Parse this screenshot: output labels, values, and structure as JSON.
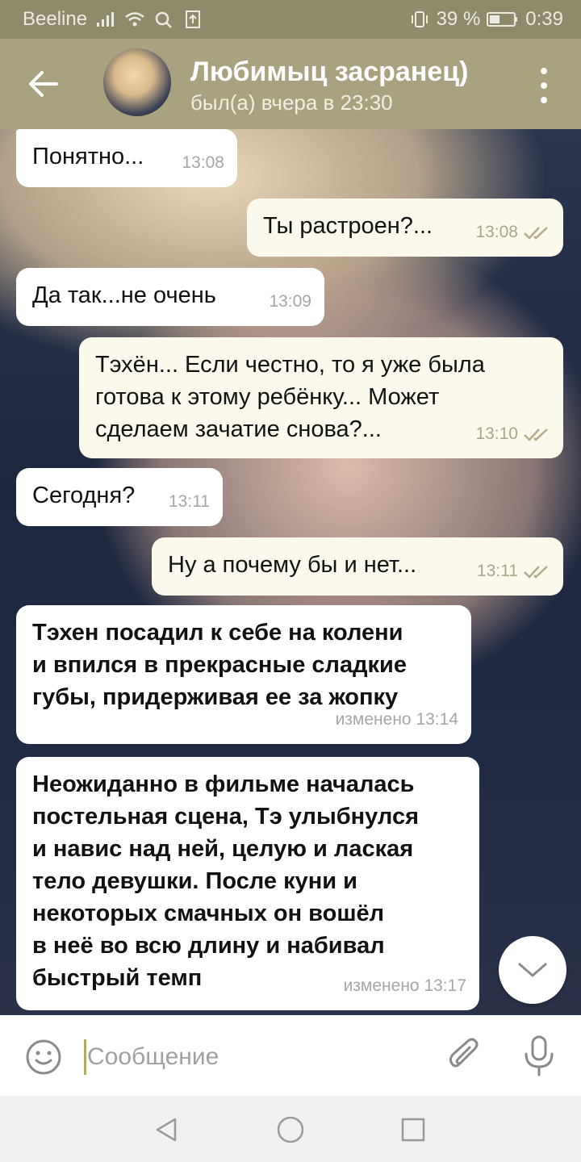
{
  "status_bar": {
    "carrier": "Beeline",
    "battery_percent": "39 %",
    "time": "0:39"
  },
  "header": {
    "back_icon": "arrow-left-icon",
    "contact_name": "Любимыц засранец)",
    "last_seen": "был(а) вчера в 23:30",
    "menu_icon": "more-vertical-icon"
  },
  "messages": [
    {
      "direction": "in",
      "text": "Понятно...",
      "time": "13:08",
      "bold": false
    },
    {
      "direction": "out",
      "text": "Ты растроен?...",
      "time": "13:08",
      "read": true,
      "bold": false
    },
    {
      "direction": "in",
      "text": "Да так...не очень",
      "time": "13:09",
      "bold": false
    },
    {
      "direction": "out",
      "text": "Тэхён... Если честно, то я уже была\nготова к этому ребёнку... Может\nсделаем зачатие снова?...",
      "time": "13:10",
      "read": true,
      "bold": false
    },
    {
      "direction": "in",
      "text": "Сегодня?",
      "time": "13:11",
      "bold": false
    },
    {
      "direction": "out",
      "text": "Ну а почему бы и нет...",
      "time": "13:11",
      "read": true,
      "bold": false
    },
    {
      "direction": "in",
      "text": "Тэхен посадил к себе на колени\nи впился в прекрасные сладкие\nгубы, придерживая ее за жопку",
      "time": "изменено 13:14",
      "bold": true
    },
    {
      "direction": "in",
      "text": "Неожиданно в фильме началась\nпостельная сцена, Тэ улыбнулся\nи навис над ней, целую и лаская\nтело девушки. После куни и\nнекоторых смачных он вошёл\nв неё во всю длину и набивал\nбыстрый темп",
      "time": "изменено 13:17",
      "bold": true
    }
  ],
  "input": {
    "placeholder": "Сообщение",
    "value": ""
  },
  "icons": {
    "emoji": "emoji-icon",
    "attach": "paperclip-icon",
    "mic": "microphone-icon",
    "scroll_down": "chevron-down-icon"
  },
  "colors": {
    "header_bg": "#a8a27e",
    "status_bg": "#8f8a6a",
    "outgoing_bubble": "#fbf9ec",
    "incoming_bubble": "#ffffff",
    "read_ticks": "#b3ad86"
  }
}
